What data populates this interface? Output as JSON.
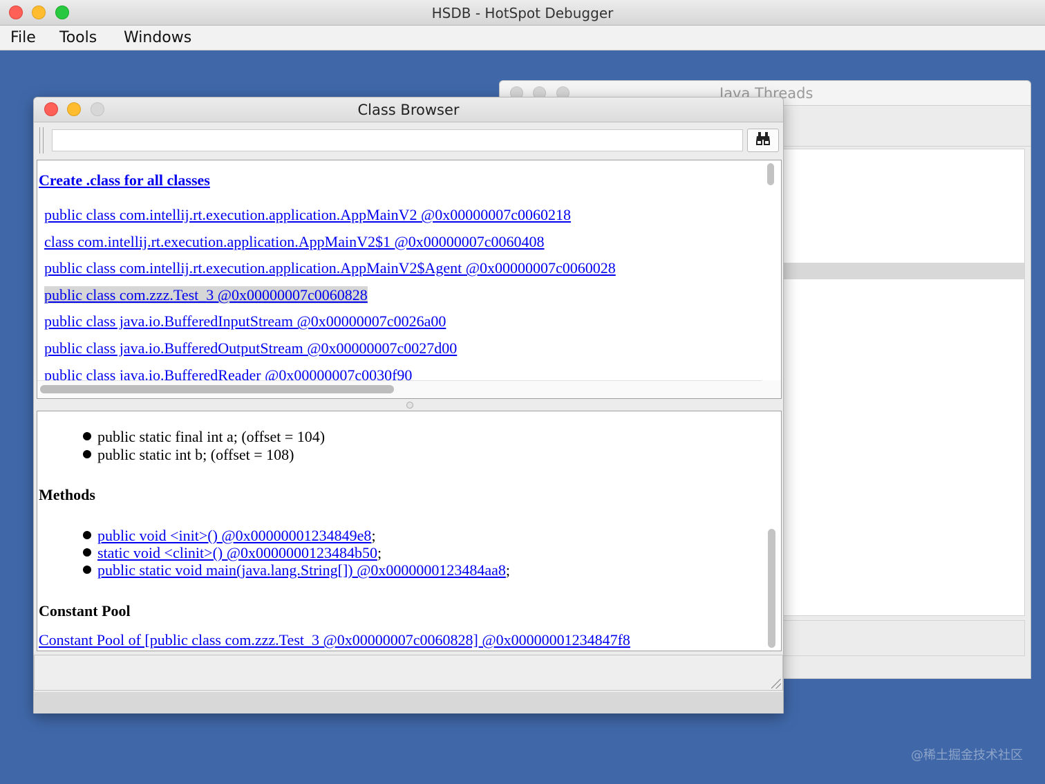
{
  "app": {
    "title": "HSDB - HotSpot Debugger"
  },
  "menu": {
    "items": [
      "File",
      "Tools",
      "Windows"
    ]
  },
  "background_window": {
    "title": "Java Threads"
  },
  "class_browser": {
    "title": "Class Browser",
    "search": {
      "value": "",
      "icon": "binoculars-icon"
    },
    "create_link": "Create .class for all classes",
    "classes": [
      "public class com.intellij.rt.execution.application.AppMainV2 @0x00000007c0060218",
      "class com.intellij.rt.execution.application.AppMainV2$1 @0x00000007c0060408",
      "public class com.intellij.rt.execution.application.AppMainV2$Agent @0x00000007c0060028",
      "public class com.zzz.Test_3 @0x00000007c0060828",
      "public class java.io.BufferedInputStream @0x00000007c0026a00",
      "public class java.io.BufferedOutputStream @0x00000007c0027d00",
      "public class java.io.BufferedReader @0x00000007c0030f90"
    ],
    "selected_class_index": 3,
    "details": {
      "fields": [
        "public static final int a; (offset = 104)",
        "public static int b; (offset = 108)"
      ],
      "methods_heading": "Methods",
      "methods": [
        "public void <init>() @0x00000001234849e8",
        "static void <clinit>() @0x0000000123484b50",
        "public static void main(java.lang.String[]) @0x0000000123484aa8"
      ],
      "method_suffix": ";",
      "constant_pool_heading": "Constant Pool",
      "constant_pool_link": "Constant Pool of [public class com.zzz.Test_3 @0x00000007c0060828] @0x00000001234847f8"
    }
  },
  "watermark": "@稀土掘金技术社区",
  "colors": {
    "desktop": "#4068a9",
    "link": "#0000ee",
    "close": "#fe5f57",
    "minimize": "#febc2e",
    "zoom": "#28c840"
  }
}
